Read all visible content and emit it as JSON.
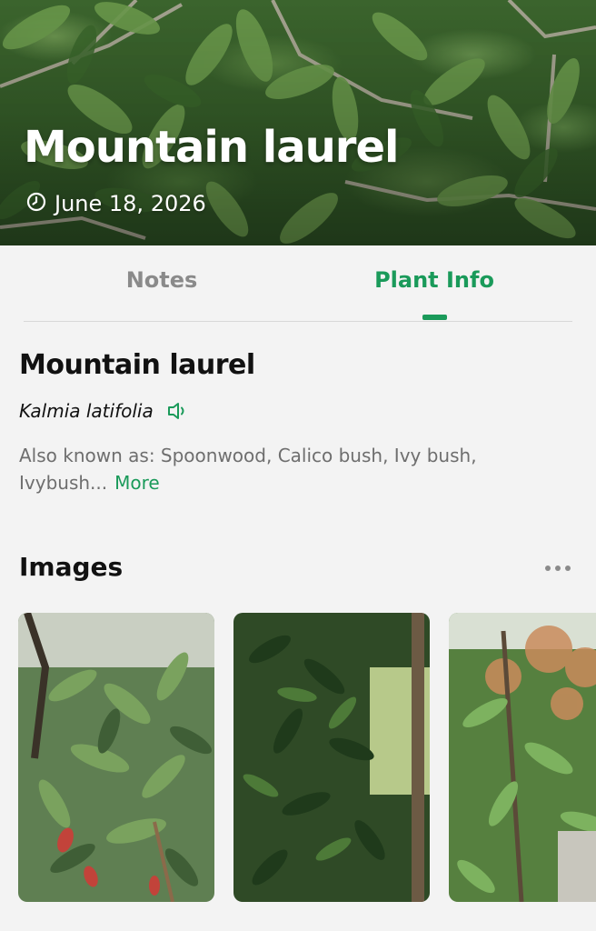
{
  "hero": {
    "title": "Mountain laurel",
    "date": "June 18, 2026",
    "date_icon": "clock-icon"
  },
  "tabs": [
    {
      "label": "Notes",
      "active": false
    },
    {
      "label": "Plant Info",
      "active": true
    }
  ],
  "plant": {
    "common_name": "Mountain laurel",
    "scientific_name": "Kalmia latifolia",
    "pronounce_icon": "speaker-icon",
    "aka_text": "Also known as: Spoonwood, Calico bush, Ivy bush, Ivybush...",
    "more_label": "More"
  },
  "images": {
    "title": "Images",
    "menu_icon": "more-dots-icon",
    "thumbnails": [
      {
        "name": "plant-photo-1"
      },
      {
        "name": "plant-photo-2"
      },
      {
        "name": "plant-photo-3"
      }
    ]
  },
  "colors": {
    "accent": "#1a9a5a",
    "inactive_tab": "#8a8a8a",
    "background": "#f3f3f3",
    "secondary_text": "#6e6e6e"
  }
}
